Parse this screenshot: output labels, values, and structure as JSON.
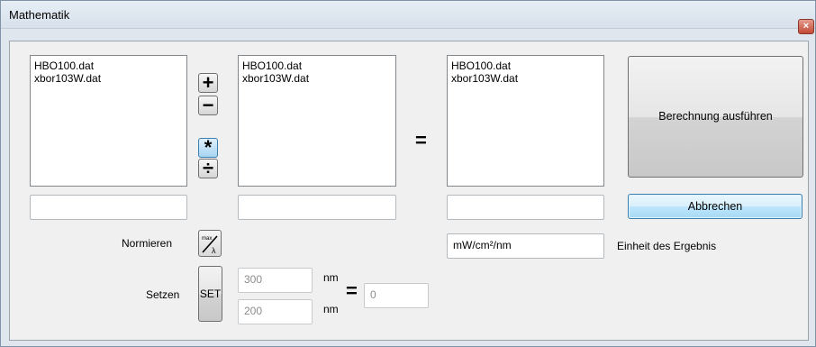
{
  "window": {
    "title": "Mathematik",
    "close_symbol": "×"
  },
  "list_a": {
    "items": [
      "HBO100.dat",
      "xbor103W.dat"
    ],
    "field_value": ""
  },
  "operations": [
    {
      "name": "add",
      "symbol": "+",
      "selected": false
    },
    {
      "name": "subtract",
      "symbol": "−",
      "selected": false
    },
    {
      "name": "multiply",
      "symbol": "*",
      "selected": true
    },
    {
      "name": "divide",
      "symbol": "÷",
      "selected": false
    }
  ],
  "list_b": {
    "items": [
      "HBO100.dat",
      "xbor103W.dat"
    ],
    "field_value": ""
  },
  "equals_symbol": "=",
  "list_result": {
    "items": [
      "HBO100.dat",
      "xbor103W.dat"
    ],
    "field_value": ""
  },
  "buttons": {
    "run_label": "Berechnung ausführen",
    "cancel_label": "Abbrechen",
    "set_label": "SET"
  },
  "normalize": {
    "label": "Normieren",
    "icon_text_top": "max",
    "icon_text_bottom": "λ"
  },
  "unit": {
    "value": "mW/cm²/nm",
    "label": "Einheit des Ergebnis"
  },
  "set_range": {
    "label": "Setzen",
    "upper_value": "300",
    "lower_value": "200",
    "unit": "nm",
    "equals_symbol": "=",
    "result_value": "0"
  }
}
